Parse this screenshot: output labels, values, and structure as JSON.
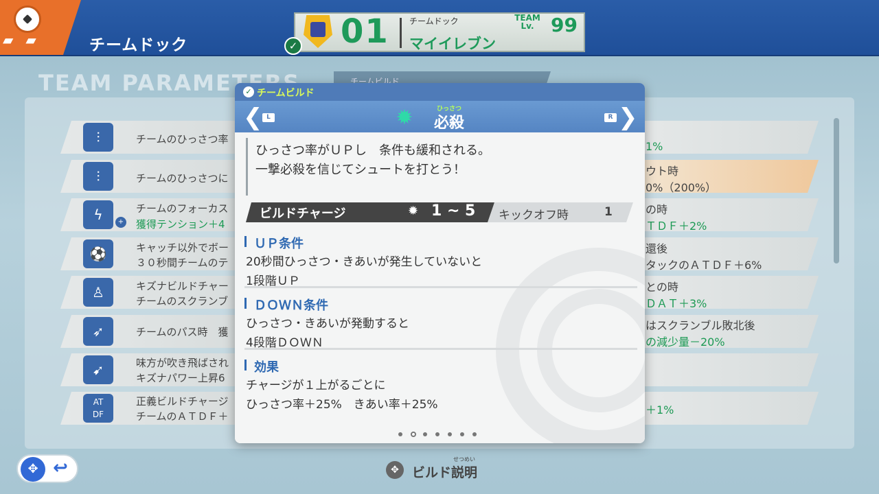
{
  "header": {
    "title": "チームドック",
    "team": {
      "number": "01",
      "sublabel": "チームドック",
      "name": "マイイレブン",
      "lv_label": "TEAM Lv.",
      "lv": "99"
    }
  },
  "section_title": "TEAM PARAMETERS",
  "background_tab": {
    "label": "チームビルド"
  },
  "left_rows": [
    {
      "icon": "tactic-icon",
      "line1": "チームのひっさつ率",
      "line2": ""
    },
    {
      "icon": "tactic-icon",
      "line1": "チームのひっさつに",
      "line2": ""
    },
    {
      "icon": "focus-icon",
      "line1": "チームのフォーカス",
      "line2": "獲得テンション＋4"
    },
    {
      "icon": "ball-icon",
      "line1": "キャッチ以外でボー",
      "line2": "３０秒間チームのテ"
    },
    {
      "icon": "bond-icon",
      "line1": "キズナビルドチャー",
      "line2": "チームのスクランブ"
    },
    {
      "icon": "pass-icon",
      "line1": "チームのパス時　獲",
      "line2": ""
    },
    {
      "icon": "blown-icon",
      "line1": "味方が吹き飛ばされ",
      "line2": "キズナパワー上昇6"
    },
    {
      "icon": "atdf-icon",
      "line1": "正義ビルドチャージ",
      "line2": "チームのＡＴＤＦ＋"
    }
  ],
  "right_rows": [
    {
      "line1": "1%",
      "line2": ""
    },
    {
      "line1": "ウト時",
      "line2": "0%（200%）"
    },
    {
      "line1": "の時",
      "line2": "ＴＤＦ＋2%"
    },
    {
      "line1": "還後",
      "line2": "タックのＡＴＤＦ＋6%"
    },
    {
      "line1": "との時",
      "line2": "ＤＡＴ＋3%"
    },
    {
      "line1": "はスクランブル敗北後",
      "line2": "の減少量－20%"
    },
    {
      "line1": "",
      "line2": ""
    },
    {
      "line1": "＋1%",
      "line2": ""
    }
  ],
  "modal": {
    "category": "チームビルド",
    "nav_left": "L",
    "nav_right": "R",
    "build_ruby": "ひっさつ",
    "build_name": "必殺",
    "description": [
      "ひっさつ率がＵＰし　条件も緩和される。",
      "一撃必殺を信じてシュートを打とう！"
    ],
    "charge": {
      "label": "ビルドチャージ",
      "range": "1 ~ 5",
      "kickoff_label": "キックオフ時",
      "kickoff_value": "1"
    },
    "up_condition": {
      "title": "ＵＰ条件",
      "line1": "20秒間ひっさつ・きあいが発生していないと",
      "line2": "1段階ＵＰ"
    },
    "down_condition": {
      "title": "ＤＯＷＮ条件",
      "line1": "ひっさつ・きあいが発動すると",
      "line2": "4段階ＤＯＷＮ"
    },
    "effect": {
      "title": "効果",
      "line1": "チャージが１上がるごとに",
      "line2": "ひっさつ率＋25%　きあい率＋25%"
    },
    "page_total": 7,
    "page_current": 2
  },
  "footer": {
    "help_label": "ビルド説明",
    "help_ruby": "せつめい"
  },
  "colors": {
    "header": "#2a5da8",
    "accent_green": "#1d9a55",
    "modal_head": "#5f8fcb",
    "section_blue": "#2f69b2"
  }
}
